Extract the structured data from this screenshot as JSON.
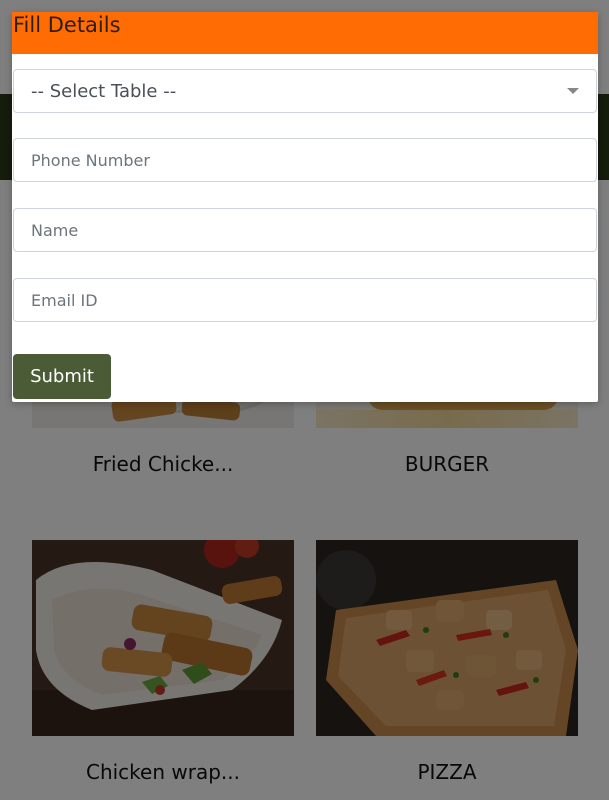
{
  "modal": {
    "title": "Fill Details",
    "table_select": {
      "value": "-- Select Table --"
    },
    "phone": {
      "placeholder": "Phone Number",
      "value": ""
    },
    "name": {
      "placeholder": "Name",
      "value": ""
    },
    "email": {
      "placeholder": "Email ID",
      "value": ""
    },
    "submit_label": "Submit"
  },
  "menu": {
    "items": [
      {
        "label": "Fried Chicke..."
      },
      {
        "label": "BURGER"
      },
      {
        "label": "Chicken wrap..."
      },
      {
        "label": "PIZZA"
      }
    ]
  },
  "colors": {
    "header": "#ff6c04",
    "submit": "#4b5b35",
    "top_bar": "#2b3818",
    "backdrop": "rgba(0,0,0,0.5)"
  }
}
